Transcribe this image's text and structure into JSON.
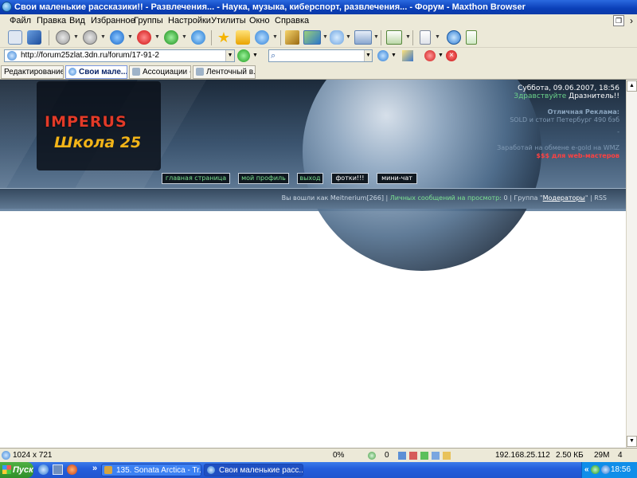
{
  "window": {
    "title": "Свои маленькие рассказики!! - Развлечения... - Наука, музыка, киберспорт, развлечения... - Форум - Maxthon Browser"
  },
  "menu": [
    "Файл",
    "Правка",
    "Вид",
    "Избранное",
    "Группы",
    "Настройки",
    "Утилиты",
    "Окно",
    "Справка"
  ],
  "address": {
    "url": "http://forum25zlat.3dn.ru/forum/17-91-2",
    "search_value": ""
  },
  "tabs": [
    "Редактирование...",
    "Свои мале...",
    "Ассоциации -...",
    "Ленточный в..."
  ],
  "site": {
    "logo_top": "IMPERUS",
    "logo_bottom": "Школа 25",
    "date": "Суббота, 09.06.2007, 18:56",
    "greeting_prefix": "Здравствуйте",
    "greeting_name": "Дразнитель!!",
    "ads_title": "Отличная Реклама:",
    "ad_lines": [
      "SOLD и стоит Петербург 490 бэб",
      "-",
      "Заработай на обмене e-gold на WMZ"
    ],
    "ad_red": "$$$ для web-мастеров",
    "nav": [
      "главная страница",
      "мой профиль",
      "выход",
      "фотки!!!",
      "мини-чат"
    ],
    "info": {
      "logged_in": "Вы вошли как",
      "user": "Meitnerium[266]",
      "messages": "Личных сообщений на просмотр:",
      "messages_count": "0",
      "group_label": "Группа",
      "group_name": "Модераторы",
      "rss": "RSS"
    }
  },
  "status": {
    "resolution": "1024 x 721",
    "progress": "0%",
    "blocked": "0",
    "ip": "192.168.25.112",
    "size": "2.50 КБ",
    "memory": "29M",
    "tabs_count": "4"
  },
  "taskbar": {
    "start": "Пуск",
    "tasks": [
      "135. Sonata Arctica - Tr...",
      "Свои маленькие расс..."
    ],
    "chevron": "»",
    "clock": "18:56"
  }
}
